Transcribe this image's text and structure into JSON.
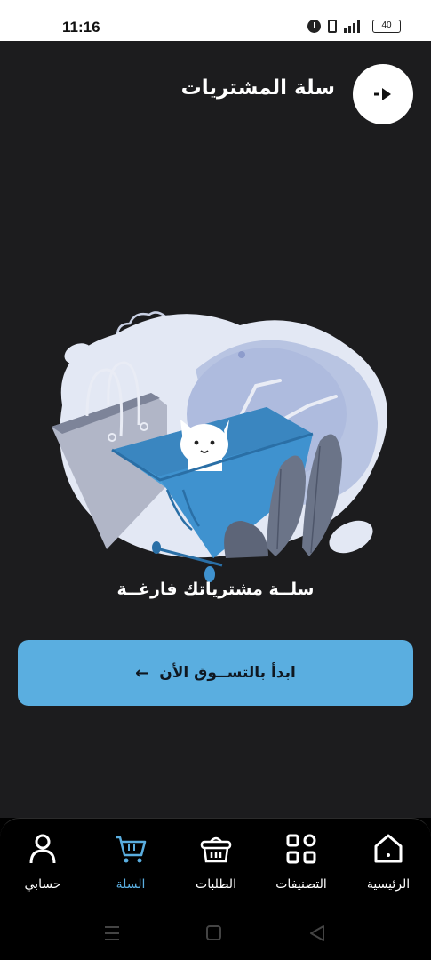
{
  "status_bar": {
    "time": "11:16",
    "battery": "40"
  },
  "header": {
    "title": "سلة المشتريات",
    "back_icon": "arrow-back-icon"
  },
  "empty_state": {
    "message": "سلــة مشترياتك فارغــة",
    "illustration": "empty-shopping-cart-illustration"
  },
  "cta": {
    "label": "ابدأ بالتســوق الأن",
    "icon": "arrow-left-icon"
  },
  "bottom_nav": {
    "items": [
      {
        "label": "الرئيسية",
        "icon": "home-icon",
        "active": false
      },
      {
        "label": "التصنيفات",
        "icon": "categories-icon",
        "active": false
      },
      {
        "label": "الطلبات",
        "icon": "basket-icon",
        "active": false
      },
      {
        "label": "السلة",
        "icon": "cart-icon",
        "active": true
      },
      {
        "label": "حسابي",
        "icon": "user-icon",
        "active": false
      }
    ]
  },
  "colors": {
    "accent": "#5aaee0",
    "background": "#1c1c1e",
    "nav_background": "#000000"
  }
}
